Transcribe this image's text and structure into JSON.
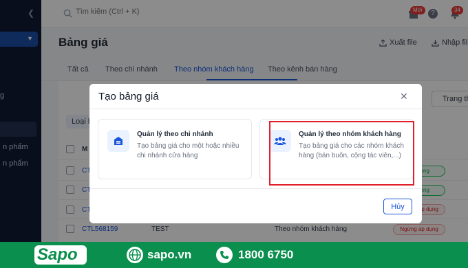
{
  "topbar": {
    "search_placeholder": "Tìm kiếm (Ctrl + K)",
    "new_badge": "Mới",
    "help_glyph": "?",
    "notification_count": "34"
  },
  "page": {
    "title": "Bảng giá",
    "export_label": "Xuất file",
    "import_label": "Nhập fil"
  },
  "tabs": [
    {
      "label": "Tất cả"
    },
    {
      "label": "Theo chi nhánh"
    },
    {
      "label": "Theo nhóm khách hàng",
      "active": true
    },
    {
      "label": "Theo kênh bán hàng"
    }
  ],
  "sidebar": {
    "items": [
      "g",
      "n phẩm",
      "n phẩm"
    ]
  },
  "filter": {
    "status_label": "Trạng th",
    "chip_label": "Loại b"
  },
  "table": {
    "header_first": "M",
    "rows": [
      {
        "code": "CT",
        "status": "Áp dụng"
      },
      {
        "code": "CT",
        "status": "Áp dụng"
      },
      {
        "code": "CT",
        "status": "Ngừng áp dụng"
      },
      {
        "code": "CTL568159",
        "name": "TEST",
        "type": "Theo nhóm khách hàng",
        "status": "Ngừng áp dụng"
      }
    ]
  },
  "modal": {
    "title": "Tạo bảng giá",
    "cards": {
      "branch": {
        "title": "Quản lý theo chi nhánh",
        "desc": "Tạo bảng giá cho một hoặc nhiều chi nhánh cửa hàng"
      },
      "group": {
        "title": "Quản lý theo nhóm khách hàng",
        "desc": "Tạo bảng giá cho các nhóm khách hàng (bán buôn, cộng tác viên,...)"
      }
    },
    "cancel_label": "Hủy"
  },
  "banner": {
    "logo": "Sapo",
    "website": "sapo.vn",
    "hotline": "1800 6750"
  },
  "colors": {
    "accent": "#1a56db",
    "sidebar": "#0f1b33",
    "banner": "#0a8f4e",
    "highlight": "#e11d2a"
  }
}
